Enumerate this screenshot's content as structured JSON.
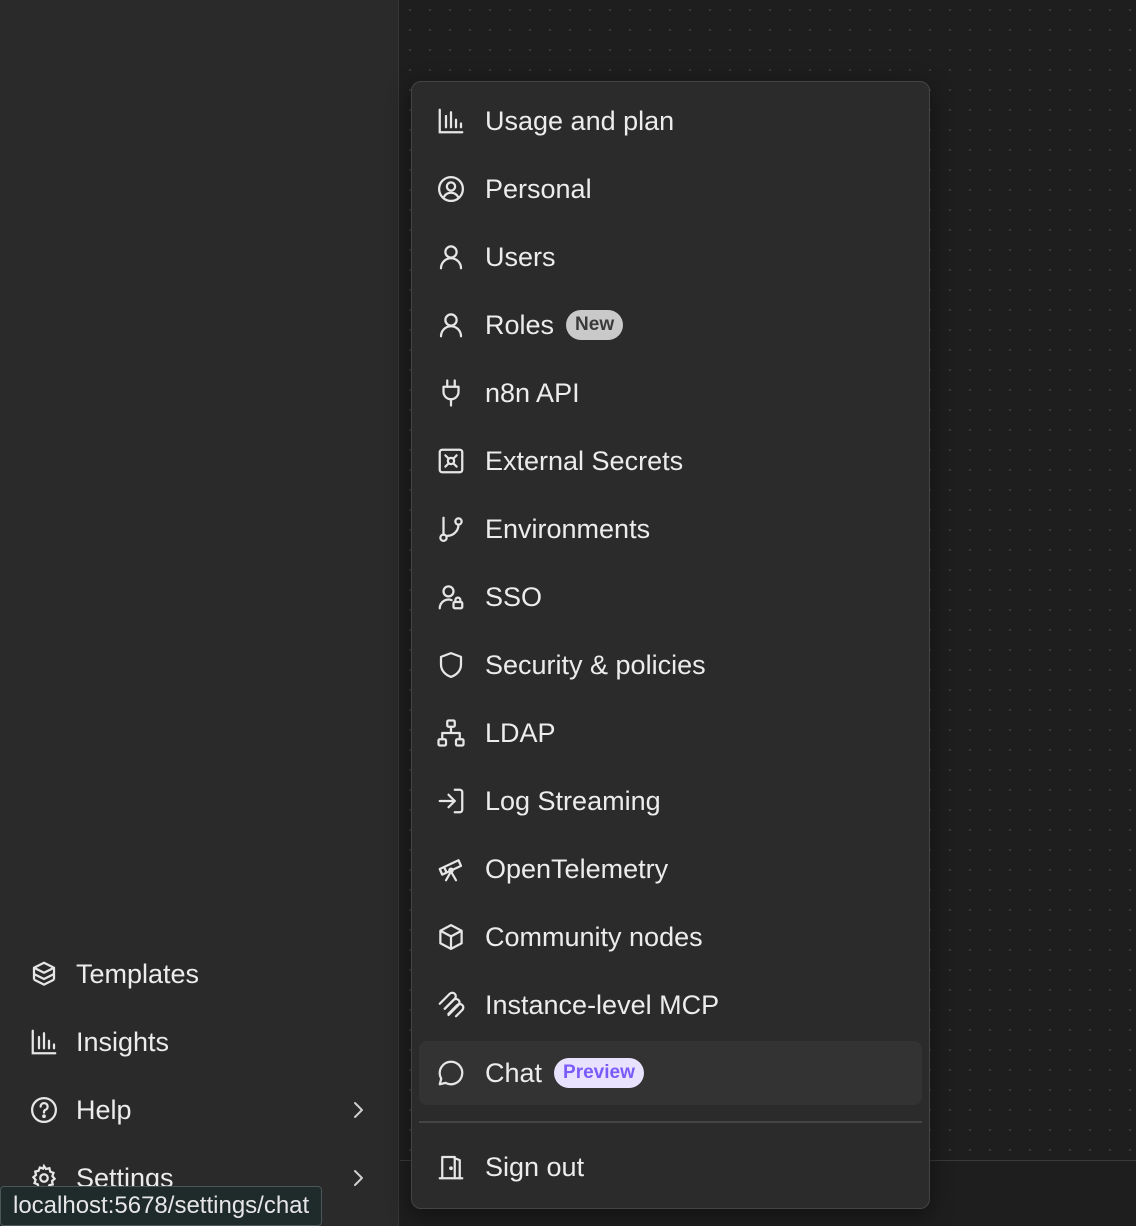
{
  "sidebar": {
    "items": [
      {
        "label": "Templates",
        "icon": "templates-icon"
      },
      {
        "label": "Insights",
        "icon": "insights-icon"
      },
      {
        "label": "Help",
        "icon": "help-icon"
      },
      {
        "label": "Settings",
        "icon": "gear-icon"
      }
    ]
  },
  "menu": {
    "items": [
      {
        "label": "Usage and plan",
        "icon": "usage-chart-icon"
      },
      {
        "label": "Personal",
        "icon": "user-circle-icon"
      },
      {
        "label": "Users",
        "icon": "user-icon"
      },
      {
        "label": "Roles",
        "icon": "user-icon",
        "badge": "New"
      },
      {
        "label": "n8n API",
        "icon": "plug-icon"
      },
      {
        "label": "External Secrets",
        "icon": "vault-icon"
      },
      {
        "label": "Environments",
        "icon": "git-branch-icon"
      },
      {
        "label": "SSO",
        "icon": "user-lock-icon"
      },
      {
        "label": "Security & policies",
        "icon": "shield-icon"
      },
      {
        "label": "LDAP",
        "icon": "network-icon"
      },
      {
        "label": "Log Streaming",
        "icon": "log-in-icon"
      },
      {
        "label": "OpenTelemetry",
        "icon": "telescope-icon"
      },
      {
        "label": "Community nodes",
        "icon": "box-icon"
      },
      {
        "label": "Instance-level MCP",
        "icon": "mcp-icon"
      },
      {
        "label": "Chat",
        "icon": "chat-bubble-icon",
        "badge": "Preview"
      }
    ],
    "signout": {
      "label": "Sign out",
      "icon": "door-exit-icon"
    }
  },
  "tooltip": {
    "url": "localhost:5678/settings/chat"
  }
}
